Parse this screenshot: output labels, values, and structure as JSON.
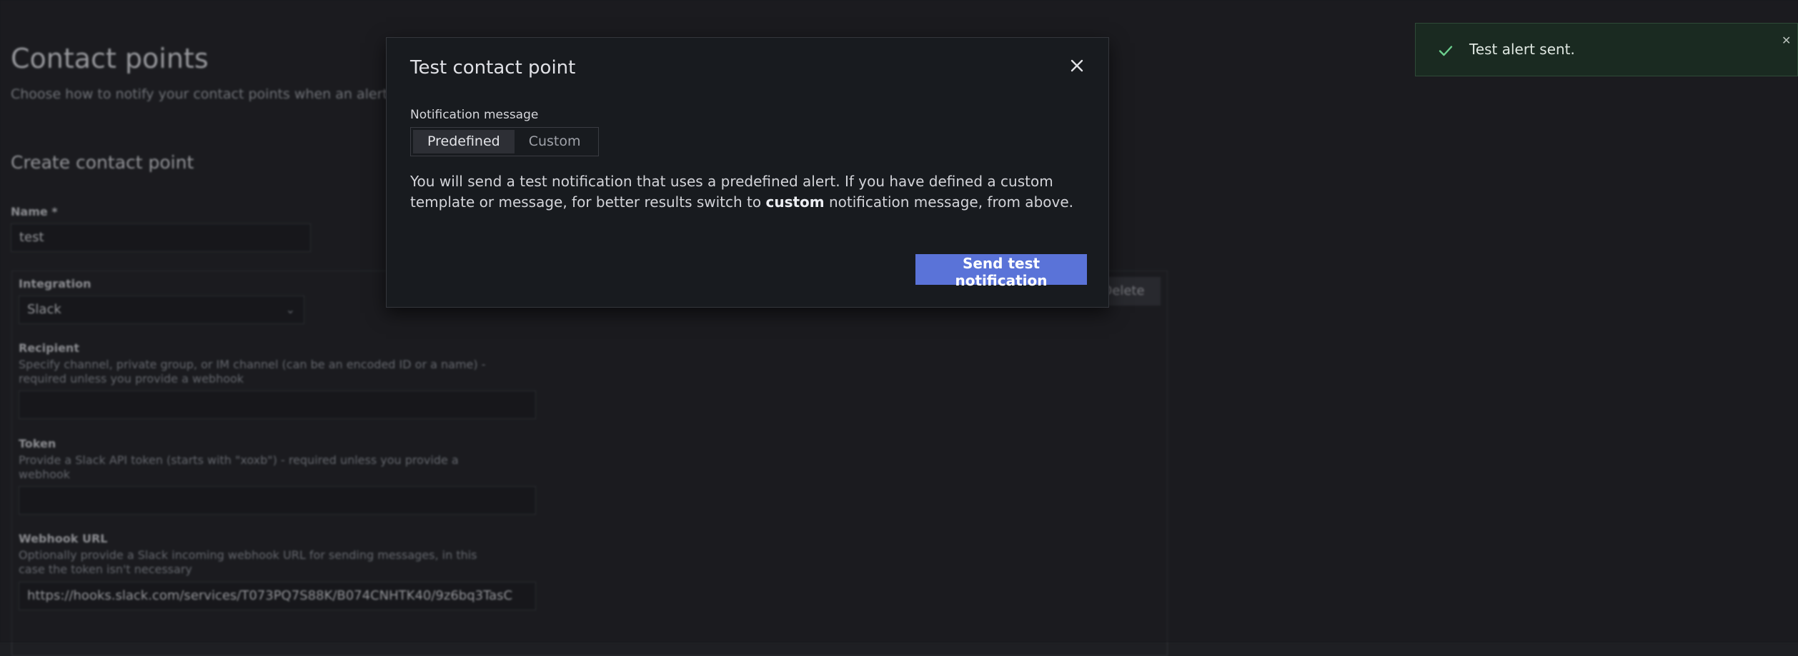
{
  "page": {
    "title": "Contact points",
    "subtitle": "Choose how to notify your contact points when an alert instance fires",
    "section_title": "Create contact point",
    "name_label": "Name *",
    "name_value": "test",
    "integration_label": "Integration",
    "integration_value": "Slack",
    "delete_label": "Delete",
    "recipient_label": "Recipient",
    "recipient_desc": "Specify channel, private group, or IM channel (can be an encoded ID or a name) - required unless you provide a webhook",
    "token_label": "Token",
    "token_desc": "Provide a Slack API token (starts with \"xoxb\") - required unless you provide a webhook",
    "webhook_label": "Webhook URL",
    "webhook_desc": "Optionally provide a Slack incoming webhook URL for sending messages, in this case the token isn't necessary",
    "webhook_value": "https://hooks.slack.com/services/T073PQ7S88K/B074CNHTK40/9z6bq3TasC"
  },
  "modal": {
    "title": "Test contact point",
    "field_label": "Notification message",
    "options": [
      "Predefined",
      "Custom"
    ],
    "selected": "Predefined",
    "body_pre": "You will send a test notification that uses a predefined alert. If you have defined a custom template or message, for better results switch to ",
    "body_bold": "custom",
    "body_post": " notification message, from above.",
    "submit_label": "Send test notification"
  },
  "toast": {
    "message": "Test alert sent.",
    "status_color": "#6ccf8e"
  },
  "icons": {
    "modal_close": "close-icon",
    "toast_check": "check-icon",
    "toast_close": "close-icon",
    "select_chevron": "chevron-down-icon"
  }
}
